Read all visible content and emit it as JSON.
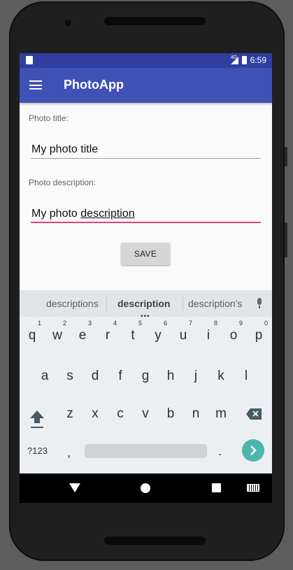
{
  "status_bar": {
    "network": "4G",
    "time": "6:59"
  },
  "app_bar": {
    "title": "PhotoApp"
  },
  "form": {
    "title_label": "Photo title:",
    "title_value": "My photo title",
    "description_label": "Photo description:",
    "description_value_prefix": "My photo ",
    "description_value_word": "description",
    "save_label": "SAVE"
  },
  "keyboard": {
    "suggestions": [
      "descriptions",
      "description",
      "description's"
    ],
    "row1": [
      "q",
      "w",
      "e",
      "r",
      "t",
      "y",
      "u",
      "i",
      "o",
      "p"
    ],
    "row1_hints": [
      "1",
      "2",
      "3",
      "4",
      "5",
      "6",
      "7",
      "8",
      "9",
      "0"
    ],
    "row2": [
      "a",
      "s",
      "d",
      "f",
      "g",
      "h",
      "j",
      "k",
      "l"
    ],
    "row3": [
      "z",
      "x",
      "c",
      "v",
      "b",
      "n",
      "m"
    ],
    "symbols_label": "?123",
    "comma": ",",
    "period": "."
  },
  "colors": {
    "primary": "#3f51b5",
    "primary_dark": "#303f9f",
    "accent": "#ec407a",
    "keyboard_action": "#4db6ac"
  }
}
